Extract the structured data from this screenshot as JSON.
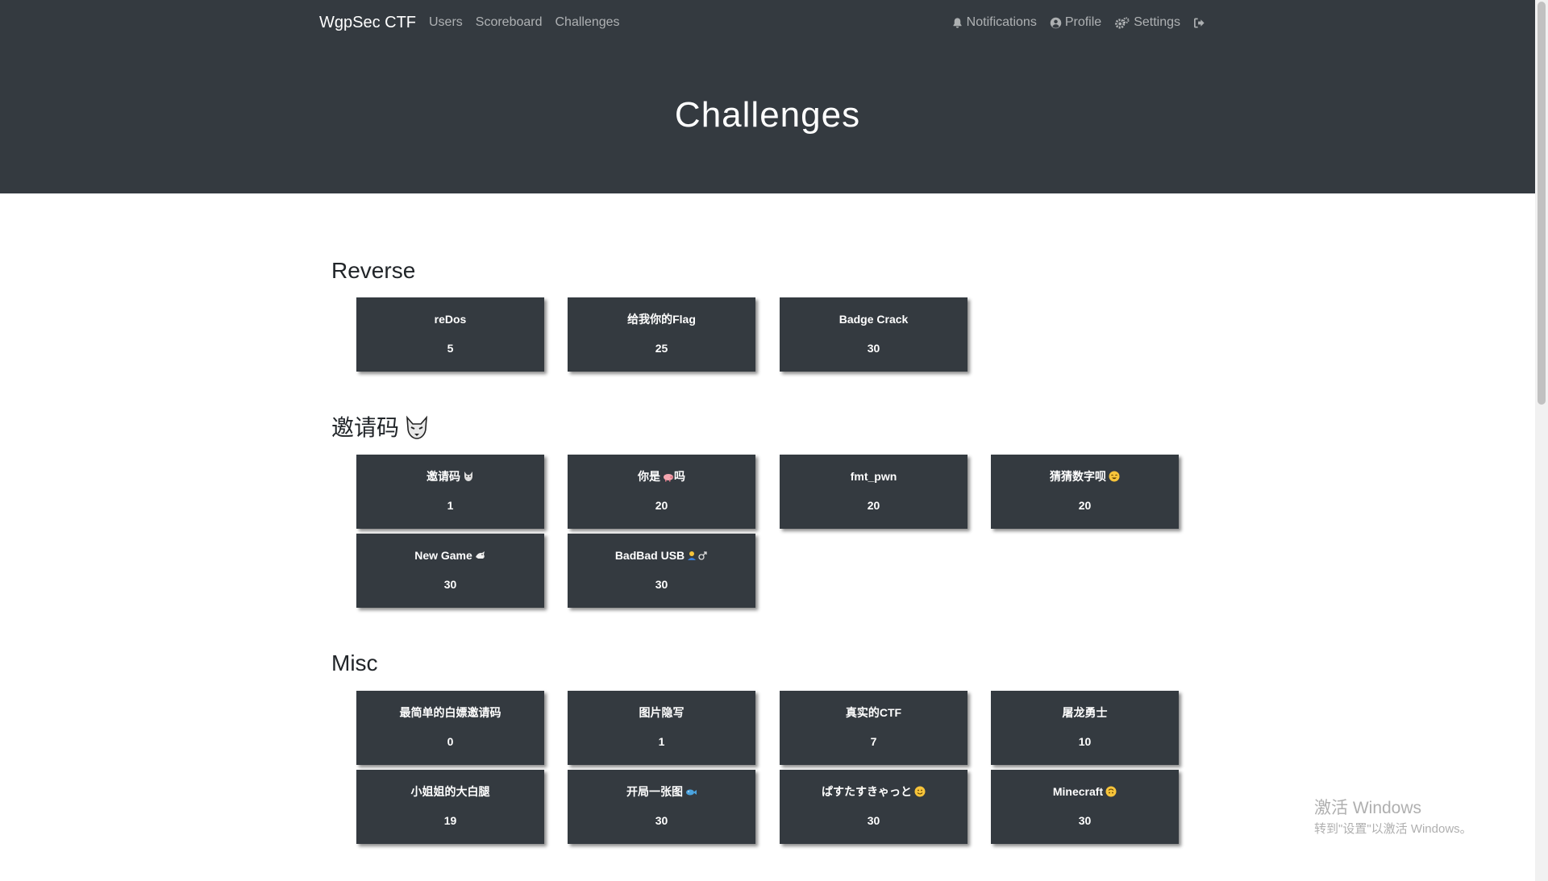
{
  "navbar": {
    "brand": "WgpSec CTF",
    "links": [
      "Users",
      "Scoreboard",
      "Challenges"
    ],
    "notifications": "Notifications",
    "profile": "Profile",
    "settings": "Settings"
  },
  "page_title": "Challenges",
  "categories": [
    {
      "name": "Reverse",
      "challenges": [
        {
          "name": "reDos",
          "value": "5"
        },
        {
          "name": "给我你的Flag",
          "value": "25"
        },
        {
          "name": "Badge Crack",
          "value": "30"
        }
      ]
    },
    {
      "name": "邀请码",
      "icon": "wolf-face-emoji",
      "challenges": [
        {
          "name": "邀请码",
          "icon": "wolf-face-emoji",
          "value": "1"
        },
        {
          "name": "你是",
          "icon": "pig-emoji",
          "suffix": "吗",
          "value": "20"
        },
        {
          "name": "fmt_pwn",
          "value": "20"
        },
        {
          "name": "猜猜数字呗",
          "icon": "smiling-face-emoji",
          "value": "20"
        },
        {
          "name": "New Game",
          "icon": "dragon-emoji",
          "value": "30"
        },
        {
          "name": "BadBad USB",
          "icon": "person-male-emoji",
          "value": "30"
        }
      ]
    },
    {
      "name": "Misc",
      "challenges": [
        {
          "name": "最简单的白嫖邀请码",
          "value": "0"
        },
        {
          "name": "图片隐写",
          "value": "1"
        },
        {
          "name": "真实的CTF",
          "value": "7"
        },
        {
          "name": "屠龙勇士",
          "value": "10"
        },
        {
          "name": "小姐姐的大白腿",
          "value": "19"
        },
        {
          "name": "开局一张图",
          "icon": "fish-emoji",
          "value": "30"
        },
        {
          "name": "ぱすたすきゃっと",
          "icon": "slightly-smiling-face-emoji",
          "value": "30"
        },
        {
          "name": "Minecraft",
          "icon": "upside-down-face-emoji",
          "value": "30"
        }
      ]
    }
  ],
  "watermark": {
    "line1": "激活 Windows",
    "line2": "转到\"设置\"以激活 Windows。"
  },
  "colors": {
    "navbar_bg": "#343a40",
    "card_bg": "#343a40",
    "page_bg": "#ffffff"
  }
}
